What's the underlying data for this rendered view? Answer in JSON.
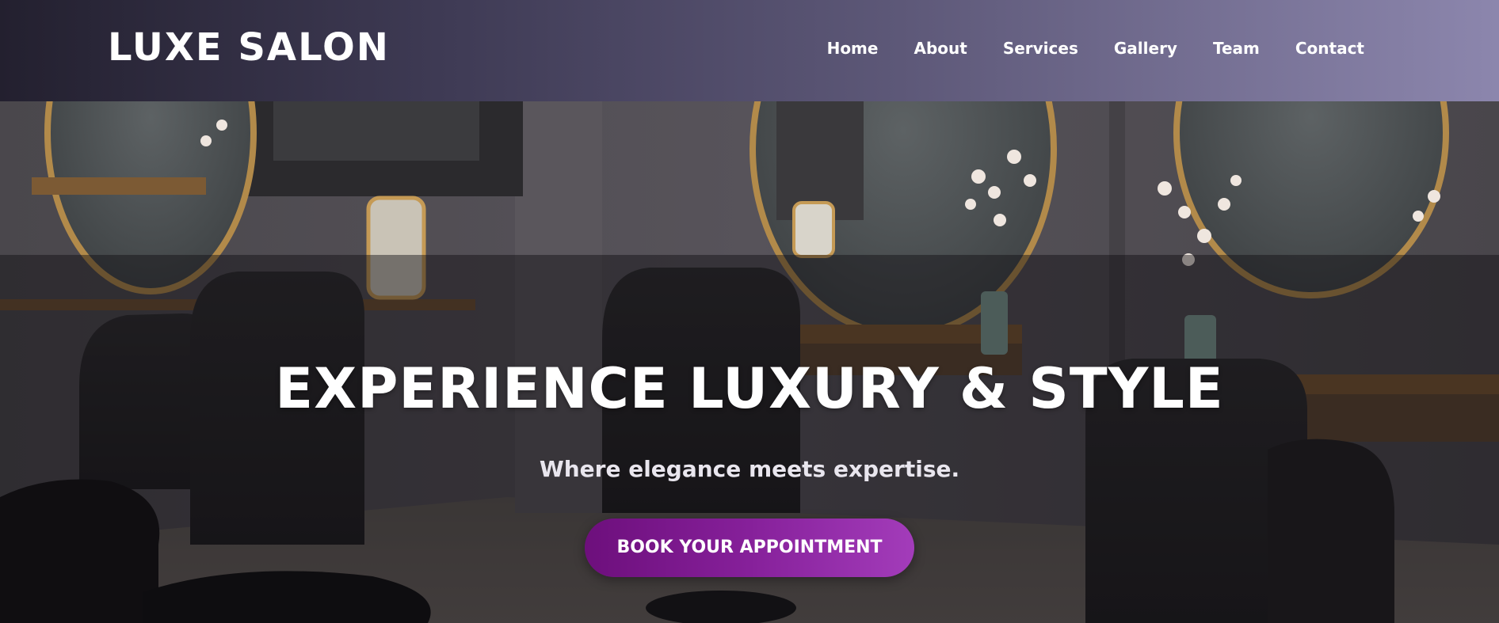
{
  "header": {
    "brand": "LUXE SALON",
    "nav": [
      {
        "label": "Home"
      },
      {
        "label": "About"
      },
      {
        "label": "Services"
      },
      {
        "label": "Gallery"
      },
      {
        "label": "Team"
      },
      {
        "label": "Contact"
      }
    ]
  },
  "hero": {
    "title": "EXPERIENCE LUXURY & STYLE",
    "subtitle": "Where elegance meets expertise.",
    "cta_label": "BOOK YOUR APPOINTMENT",
    "background_description_icon": "salon-interior-image"
  },
  "colors": {
    "header_gradient_start": "#23202f",
    "header_gradient_end": "#8c86ad",
    "cta_gradient_start": "#6d0f7c",
    "cta_gradient_end": "#a33cba",
    "text": "#ffffff"
  }
}
